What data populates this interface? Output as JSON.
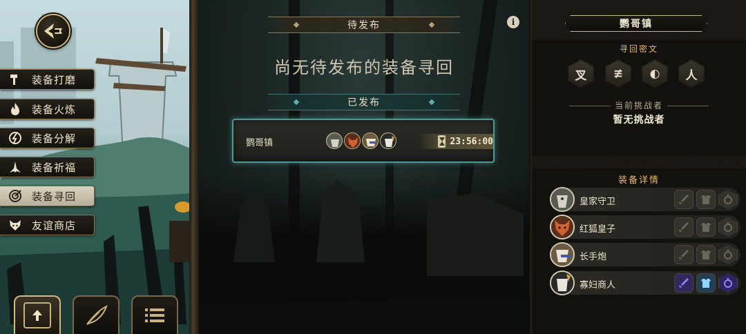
{
  "menu": {
    "items": [
      {
        "label": "装备打磨",
        "icon": "hammer-icon",
        "active": false
      },
      {
        "label": "装备火炼",
        "icon": "flame-icon",
        "active": false
      },
      {
        "label": "装备分解",
        "icon": "break-icon",
        "active": false
      },
      {
        "label": "装备祈福",
        "icon": "pray-icon",
        "active": false
      },
      {
        "label": "装备寻回",
        "icon": "target-icon",
        "active": true
      },
      {
        "label": "友谊商店",
        "icon": "fox-icon",
        "active": false
      }
    ]
  },
  "bottom_tabs": [
    {
      "icon": "upload-icon",
      "active": true
    },
    {
      "icon": "feather-icon",
      "active": false
    },
    {
      "icon": "list-icon",
      "active": false
    }
  ],
  "center": {
    "pending_header": "待发布",
    "pending_empty": "尚无待发布的装备寻回",
    "published_header": "已发布",
    "published": [
      {
        "town": "鹦哥镇",
        "avatars": [
          "guard-avatar",
          "red-fox-avatar",
          "long-gun-avatar",
          "widow-merchant-avatar"
        ],
        "timer": "23:56:00"
      }
    ]
  },
  "right": {
    "town": "鹦哥镇",
    "cipher_title": "寻回密文",
    "cipher_glyphs": [
      "叉",
      "≢",
      "◐",
      "⼈"
    ],
    "challenger_title": "当前挑战者",
    "challenger_value": "暂无挑战者",
    "equipment_title": "装备详情",
    "equipment": [
      {
        "name": "皇家守卫",
        "avatar": "guard-avatar",
        "slots_lit": false
      },
      {
        "name": "红狐皇子",
        "avatar": "red-fox-avatar",
        "slots_lit": false
      },
      {
        "name": "长手炮",
        "avatar": "long-gun-avatar",
        "slots_lit": false
      },
      {
        "name": "寡妇商人",
        "avatar": "widow-merchant-avatar",
        "slots_lit": true
      }
    ]
  },
  "colors": {
    "gold": "#c8b27e",
    "teal": "#4f9a94",
    "slot_lit_purple": "#9b7cff",
    "slot_lit_blue": "#8fd4ff"
  }
}
